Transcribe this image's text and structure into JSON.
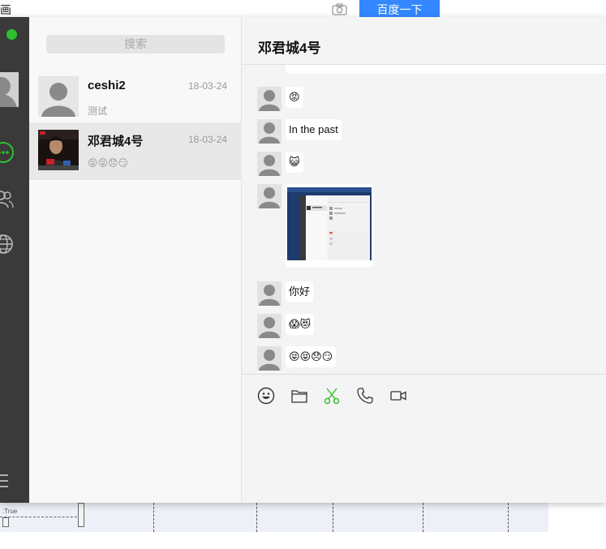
{
  "background": {
    "left_fragment": "画",
    "search_button": "百度一下",
    "bottom_label": ":True"
  },
  "nav": {
    "status_color": "#2ec02e",
    "icons": [
      "chat-icon",
      "contacts-icon",
      "globe-icon",
      "menu-icon"
    ]
  },
  "search": {
    "placeholder": "搜索"
  },
  "conversations": [
    {
      "name": "ceshi2",
      "date": "18-03-24",
      "preview": "测试",
      "active": false
    },
    {
      "name": "邓君城4号",
      "date": "18-03-24",
      "preview": "😝😝😞😏",
      "active": true
    }
  ],
  "chat": {
    "title": "邓君城4号",
    "messages": [
      {
        "type": "emoji",
        "content": "😡"
      },
      {
        "type": "text",
        "content": "In the past"
      },
      {
        "type": "emoji",
        "content": "😺"
      },
      {
        "type": "image",
        "content": "screenshot"
      },
      {
        "type": "text",
        "content": "你好"
      },
      {
        "type": "emoji",
        "content": "😱😻"
      },
      {
        "type": "emoji",
        "content": "😝😝😞😏"
      }
    ]
  },
  "toolbar": {
    "icons": [
      "emoji-icon",
      "folder-icon",
      "scissors-icon",
      "phone-icon",
      "video-icon"
    ],
    "accent": "#2ec02e"
  }
}
